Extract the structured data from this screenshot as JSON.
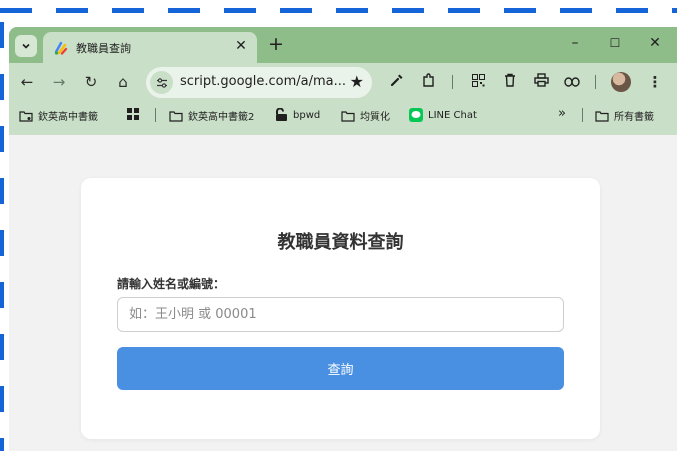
{
  "browser": {
    "tab": {
      "title": "教職員查詢",
      "close_symbol": "✕"
    },
    "new_tab_symbol": "+",
    "window_controls": {
      "minimize": "–",
      "maximize": "☐",
      "close": "✕"
    },
    "toolbar": {
      "back": "←",
      "forward": "→",
      "reload": "↻",
      "home": "⌂",
      "url": "script.google.com/a/ma...",
      "bookmark_star": "★",
      "menu": "⋮"
    },
    "bookmarks": [
      {
        "label": "欽英高中書籤",
        "icon": "folder-settings-icon"
      },
      {
        "label": "",
        "icon": "apps-grid-icon"
      },
      {
        "label": "欽英高中書籤2",
        "icon": "folder-icon"
      },
      {
        "label": "bpwd",
        "icon": "unlock-icon"
      },
      {
        "label": "均質化",
        "icon": "folder-icon"
      },
      {
        "label": "LINE Chat",
        "icon": "line-icon"
      }
    ],
    "bookmarks_overflow": "»",
    "all_bookmarks": "所有書籤"
  },
  "page": {
    "title": "教職員資料查詢",
    "field_label": "請輸入姓名或編號：",
    "input_value": "",
    "input_placeholder": "如：王小明 或 00001",
    "submit_label": "查詢"
  },
  "colors": {
    "tab_strip": "#8fbd8a",
    "toolbar": "#c9dfc8",
    "page_background": "#f2f2f2",
    "button": "#4a90e2",
    "selection_dash": "#1565d8"
  }
}
